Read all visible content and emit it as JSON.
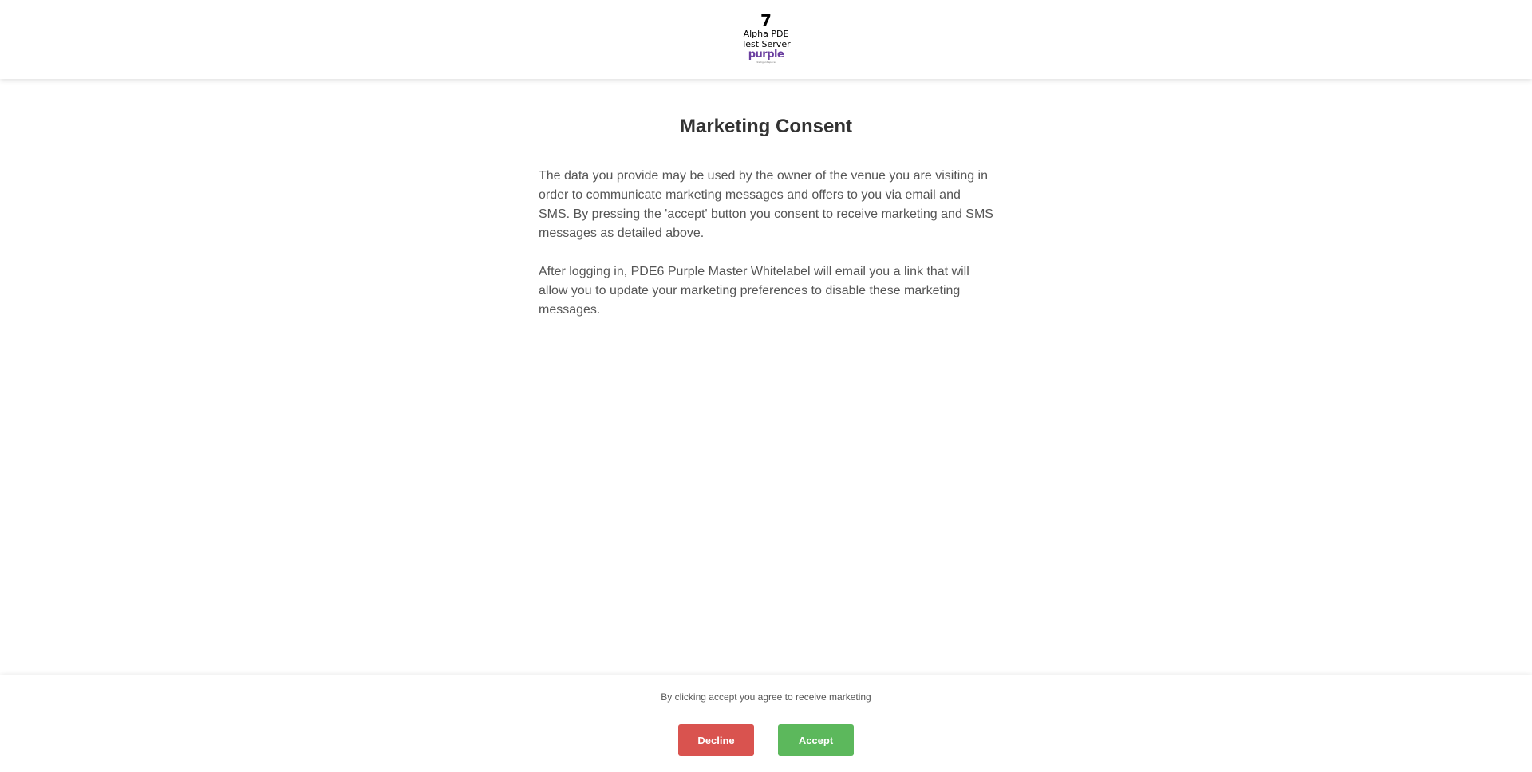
{
  "header": {
    "logo": {
      "number": "7",
      "line1": "Alpha PDE",
      "line2": "Test Server",
      "brand": "purple",
      "tagline": "intelligent spaces"
    }
  },
  "main": {
    "title": "Marketing Consent",
    "paragraphs": [
      "The data you provide may be used by the owner of the venue you are visiting in order to communicate marketing messages and offers to you via email and SMS. By pressing the 'accept' button you consent to receive marketing and SMS messages as detailed above.",
      "After logging in, PDE6 Purple Master Whitelabel will email you a link that will allow you to update your marketing preferences to disable these marketing messages."
    ]
  },
  "footer": {
    "note": "By clicking accept you agree to receive marketing",
    "decline_label": "Decline",
    "accept_label": "Accept"
  },
  "colors": {
    "decline": "#d9534f",
    "accept": "#5cb85c",
    "brand": "#6b3fa0",
    "text": "#555555",
    "title": "#333333"
  }
}
